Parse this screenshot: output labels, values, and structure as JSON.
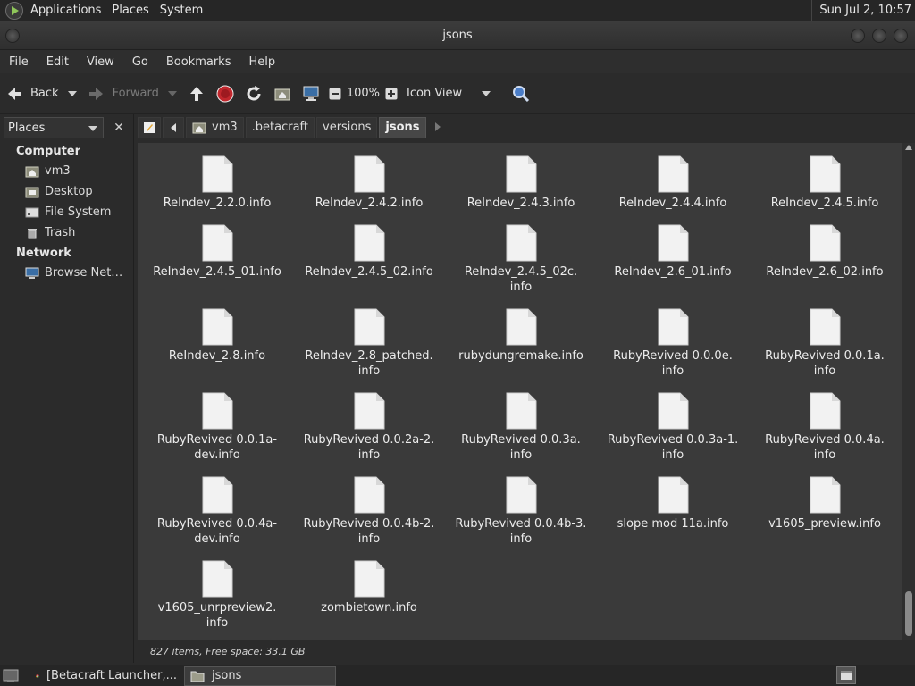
{
  "top_panel": {
    "menus": [
      "Applications",
      "Places",
      "System"
    ],
    "clock": "Sun Jul  2, 10:57"
  },
  "window": {
    "title": "jsons"
  },
  "menubar": [
    "File",
    "Edit",
    "View",
    "Go",
    "Bookmarks",
    "Help"
  ],
  "toolbar": {
    "back_label": "Back",
    "forward_label": "Forward",
    "zoom_level": "100%",
    "view_mode": "Icon View"
  },
  "sidebar": {
    "selector_label": "Places",
    "sections": [
      {
        "title": "Computer",
        "items": [
          {
            "label": "vm3",
            "icon": "home-folder-icon"
          },
          {
            "label": "Desktop",
            "icon": "desktop-folder-icon"
          },
          {
            "label": "File System",
            "icon": "drive-icon"
          },
          {
            "label": "Trash",
            "icon": "trash-icon"
          }
        ]
      },
      {
        "title": "Network",
        "items": [
          {
            "label": "Browse Net…",
            "icon": "network-icon"
          }
        ]
      }
    ]
  },
  "pathbar": {
    "crumbs": [
      "vm3",
      ".betacraft",
      "versions",
      "jsons"
    ],
    "active": "jsons"
  },
  "files": [
    "ReIndev_2.2.0.info",
    "ReIndev_2.4.2.info",
    "ReIndev_2.4.3.info",
    "ReIndev_2.4.4.info",
    "ReIndev_2.4.5.info",
    "ReIndev_2.4.5_01.info",
    "ReIndev_2.4.5_02.info",
    "ReIndev_2.4.5_02c.\ninfo",
    "ReIndev_2.6_01.info",
    "ReIndev_2.6_02.info",
    "ReIndev_2.8.info",
    "ReIndev_2.8_patched.\ninfo",
    "rubydungremake.info",
    "RubyRevived 0.0.0e.\ninfo",
    "RubyRevived 0.0.1a.\ninfo",
    "RubyRevived 0.0.1a-\ndev.info",
    "RubyRevived 0.0.2a-2.\ninfo",
    "RubyRevived 0.0.3a.\ninfo",
    "RubyRevived 0.0.3a-1.\ninfo",
    "RubyRevived 0.0.4a.\ninfo",
    "RubyRevived 0.0.4a-\ndev.info",
    "RubyRevived 0.0.4b-2.\ninfo",
    "RubyRevived 0.0.4b-3.\ninfo",
    "slope mod 11a.info",
    "v1605_preview.info",
    "v1605_unrpreview2.\ninfo",
    "zombietown.info"
  ],
  "statusbar": {
    "text": "827 items, Free space: 33.1 GB"
  },
  "taskbar": {
    "tasks": [
      {
        "label": "[Betacraft Launcher,...",
        "icon": "chrome-icon",
        "active": false
      },
      {
        "label": "jsons",
        "icon": "folder-icon",
        "active": true
      }
    ]
  },
  "colors": {
    "background": "#3a3a3a",
    "panel": "#262626",
    "accent_stop": "#c1272d"
  }
}
